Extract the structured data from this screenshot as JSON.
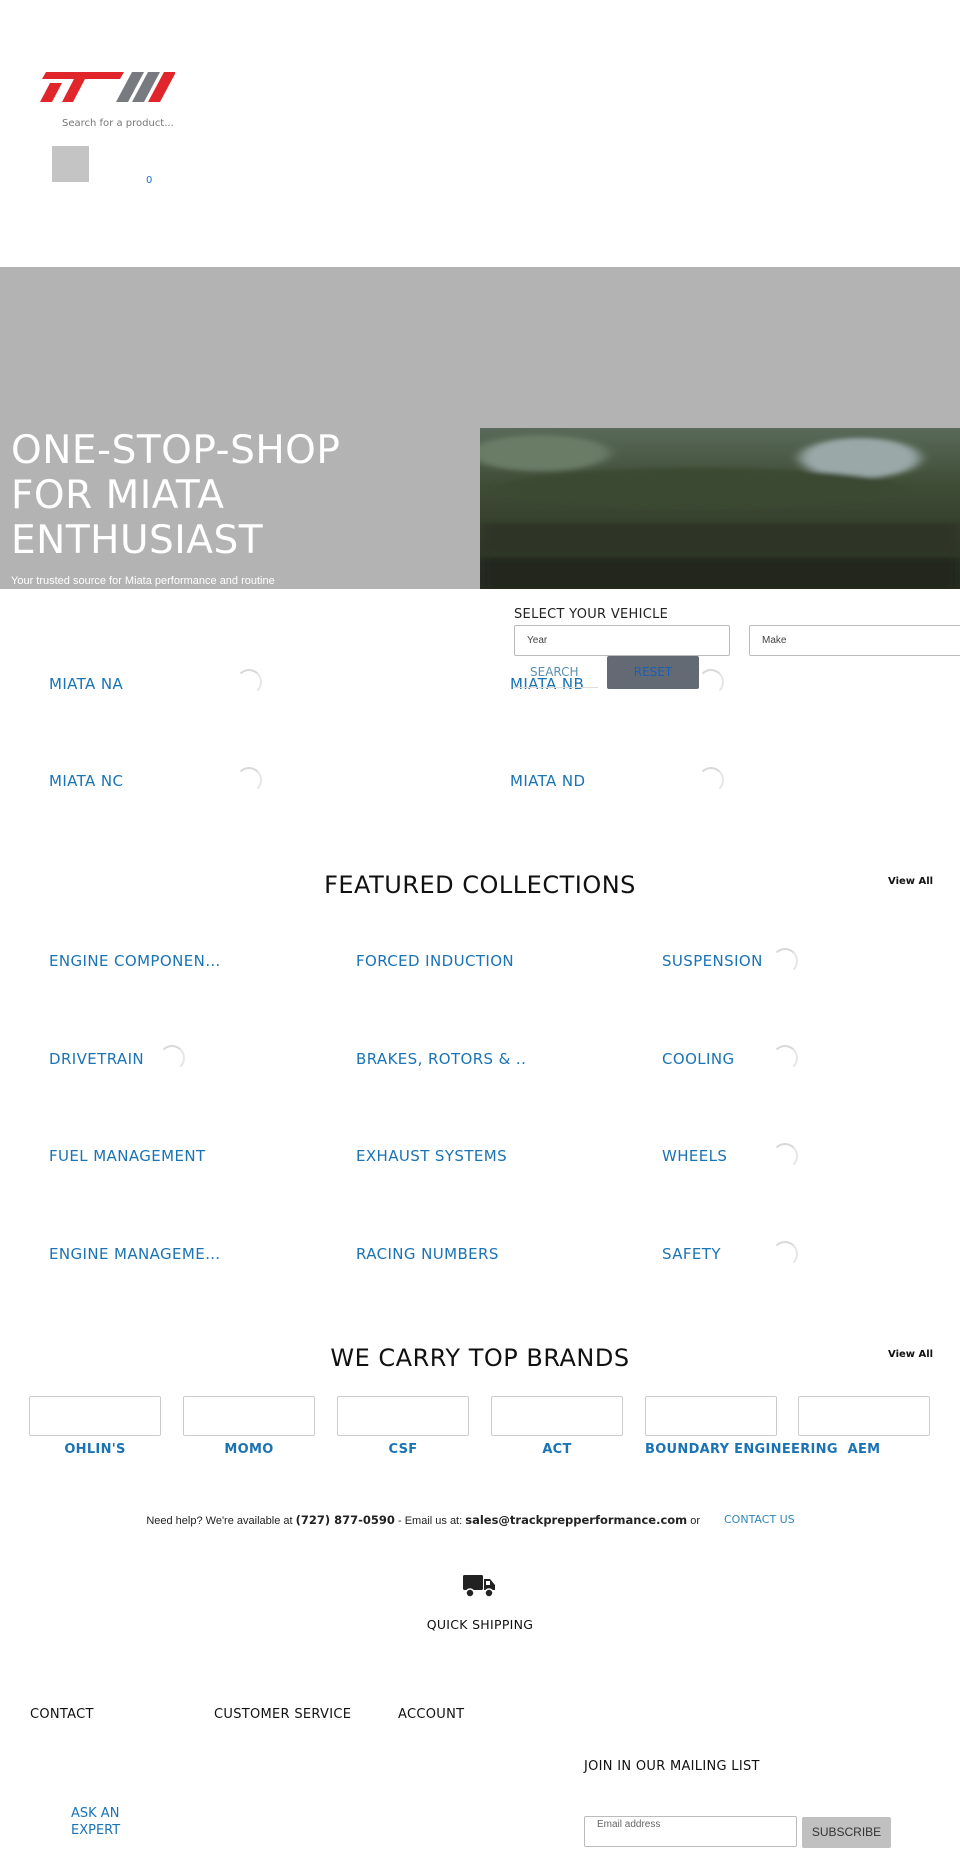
{
  "header": {
    "search_placeholder": "Search for a product...",
    "cart_count": "0"
  },
  "hero": {
    "title": "ONE-STOP-SHOP FOR MIATA ENTHUSIAST",
    "subtitle": "Your trusted source for Miata performance and routine"
  },
  "vehicle_selector": {
    "title": "SELECT YOUR VEHICLE",
    "year_placeholder": "Year",
    "make_placeholder": "Make",
    "search_label": "SEARCH",
    "reset_label": "RESET"
  },
  "models": [
    "MIATA NA",
    "MIATA NB",
    "MIATA NC",
    "MIATA ND"
  ],
  "featured": {
    "title": "FEATURED COLLECTIONS",
    "view_all": "View All",
    "items": [
      "ENGINE COMPONEN…",
      "FORCED INDUCTION",
      "SUSPENSION",
      "DRIVETRAIN",
      "BRAKES, ROTORS & ..",
      "COOLING",
      "FUEL MANAGEMENT",
      "EXHAUST SYSTEMS",
      "WHEELS",
      "ENGINE MANAGEME…",
      "RACING NUMBERS",
      "SAFETY"
    ]
  },
  "brands": {
    "title": "WE CARRY TOP BRANDS",
    "view_all": "View All",
    "items": [
      "OHLIN'S",
      "MOMO",
      "CSF",
      "ACT",
      "BOUNDARY ENGINEERING",
      "AEM"
    ]
  },
  "help": {
    "prefix": "Need help? We're available at",
    "phone": "(727) 877-0590",
    "middle": "- Email us at:",
    "email": "sales@trackprepperformance.com",
    "suffix": "or",
    "contact_link": "CONTACT US"
  },
  "shipping": {
    "label": "QUICK SHIPPING",
    "icon": "truck-icon"
  },
  "footer": {
    "contact": "CONTACT",
    "customer_service": "CUSTOMER SERVICE",
    "account": "ACCOUNT",
    "ask_expert": "ASK AN EXPERT",
    "mailing_title": "JOIN IN OUR MAILING LIST",
    "email_placeholder": "Email address",
    "subscribe": "SUBSCRIBE"
  },
  "colors": {
    "link_blue": "#1a73b5",
    "hero_gray": "#b3b3b3",
    "logo_red": "#e0262b",
    "logo_gray": "#777b80"
  }
}
